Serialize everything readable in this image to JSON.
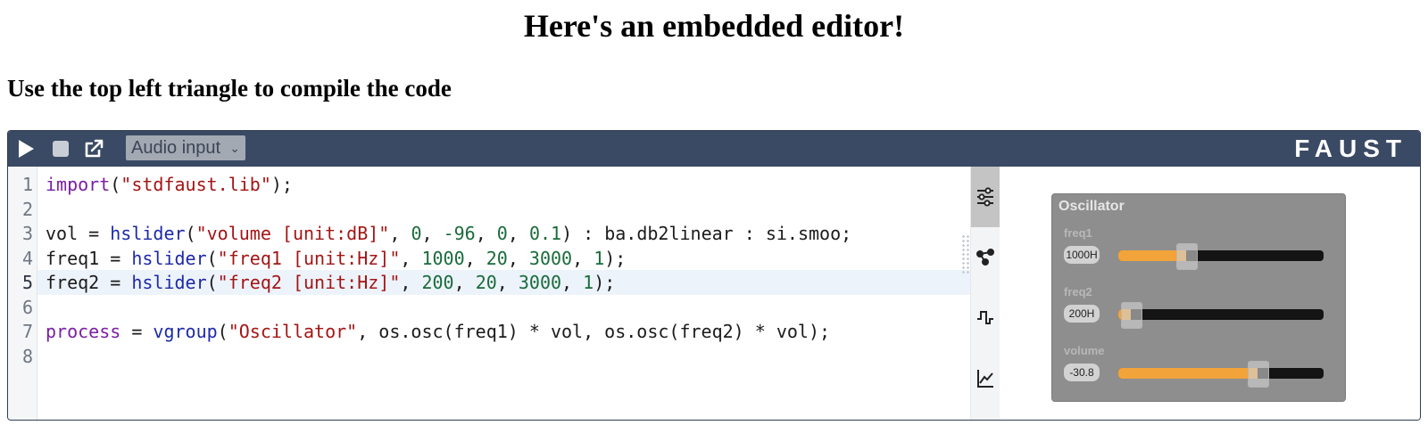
{
  "page": {
    "title": "Here's an embedded editor!",
    "subtitle": "Use the top left triangle to compile the code"
  },
  "toolbar": {
    "icons": [
      "play-icon",
      "stop-icon",
      "external-link-icon"
    ],
    "audio_input_label": "Audio input",
    "logo": "FAUST",
    "colors": {
      "bar": "#3a4a64",
      "select": "#a3a9b3"
    }
  },
  "editor": {
    "line_numbers": [
      "1",
      "2",
      "3",
      "4",
      "5",
      "6",
      "7",
      "8"
    ],
    "active_line": 5,
    "lines": [
      "import(\"stdfaust.lib\");",
      "",
      "vol = hslider(\"volume [unit:dB]\", 0, -96, 0, 0.1) : ba.db2linear : si.smoo;",
      "freq1 = hslider(\"freq1 [unit:Hz]\", 1000, 20, 3000, 1);",
      "freq2 = hslider(\"freq2 [unit:Hz]\", 200, 20, 3000, 1);",
      "",
      "process = vgroup(\"Oscillator\", os.osc(freq1) * vol, os.osc(freq2) * vol);",
      ""
    ]
  },
  "side_tabs": [
    {
      "icon": "sliders-icon",
      "active": true
    },
    {
      "icon": "diagram-icon",
      "active": false
    },
    {
      "icon": "signal-icon",
      "active": false
    },
    {
      "icon": "chart-icon",
      "active": false
    }
  ],
  "oscillator": {
    "title": "Oscillator",
    "sliders": [
      {
        "label": "freq1",
        "value_text": "1000H",
        "min": 20,
        "max": 3000,
        "value": 1000
      },
      {
        "label": "freq2",
        "value_text": "200H",
        "min": 20,
        "max": 3000,
        "value": 200
      },
      {
        "label": "volume",
        "value_text": "-30.8",
        "min": -96,
        "max": 0,
        "value": -30.8
      }
    ],
    "colors": {
      "fill": "#f2a33a",
      "track": "#141414",
      "panel": "#8e8e8e"
    }
  }
}
